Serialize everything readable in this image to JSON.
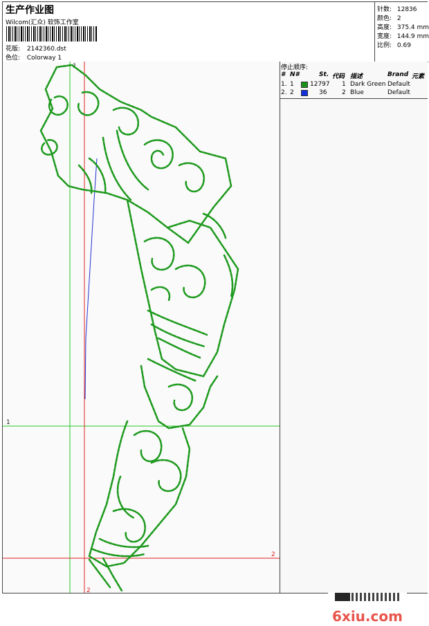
{
  "header": {
    "title": "生产作业图",
    "studio": "Wilcom(汇众) 软饰工作室",
    "design_label": "花版:",
    "design_value": "2142360.dst",
    "colorway_label": "色位:",
    "colorway_value": "Colorway 1"
  },
  "stats": {
    "stitches_label": "针数:",
    "stitches_value": "12836",
    "colors_label": "颜色:",
    "colors_value": "2",
    "height_label": "高度:",
    "height_value": "375.4 mm",
    "width_label": "宽度:",
    "width_value": "144.9 mm",
    "scale_label": "比例:",
    "scale_value": "0.69"
  },
  "stop_sequence": {
    "title": "停止顺序:",
    "columns": [
      "#",
      "N#",
      "St.",
      "代码",
      "描述",
      "Brand",
      "元素"
    ],
    "rows": [
      {
        "index": "1.",
        "n": "1",
        "color": "#1a8f1a",
        "stitches": "12797",
        "code": "1",
        "desc": "Dark Green",
        "brand": "Default"
      },
      {
        "index": "2.",
        "n": "2",
        "color": "#1030e0",
        "stitches": "36",
        "code": "2",
        "desc": "Blue",
        "brand": "Default"
      }
    ]
  },
  "markers": {
    "m1_top": "1",
    "m1_left": "1",
    "m2_right": "2",
    "m2_bottom": "2"
  },
  "colors": {
    "green_guide": "#28c828",
    "red_guide": "#e02020",
    "stitch_green": "#1e9a1e",
    "stitch_blue": "#2030d0"
  },
  "watermark": {
    "text": "6xiu.com"
  }
}
